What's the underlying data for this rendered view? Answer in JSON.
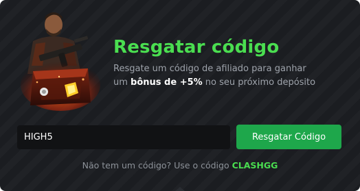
{
  "redeem": {
    "title": "Resgatar código",
    "subtitle_part1": "Resgate um código de afiliado para ganhar um ",
    "subtitle_highlight": "bônus de +5%",
    "subtitle_part2": " no seu próximo depósito",
    "input_value": "HIGH5",
    "button_label": "Resgatar Código",
    "footer_prefix": "Não tem um código? Use o código ",
    "footer_code": "CLASHGG"
  },
  "colors": {
    "background": "#1b1d21",
    "accent_green": "#4ade50",
    "button_green": "#1ea74b",
    "input_background": "#111214",
    "muted_text": "#9ea3ab"
  },
  "icons": {
    "hero_art": "character-with-case-illustration"
  }
}
